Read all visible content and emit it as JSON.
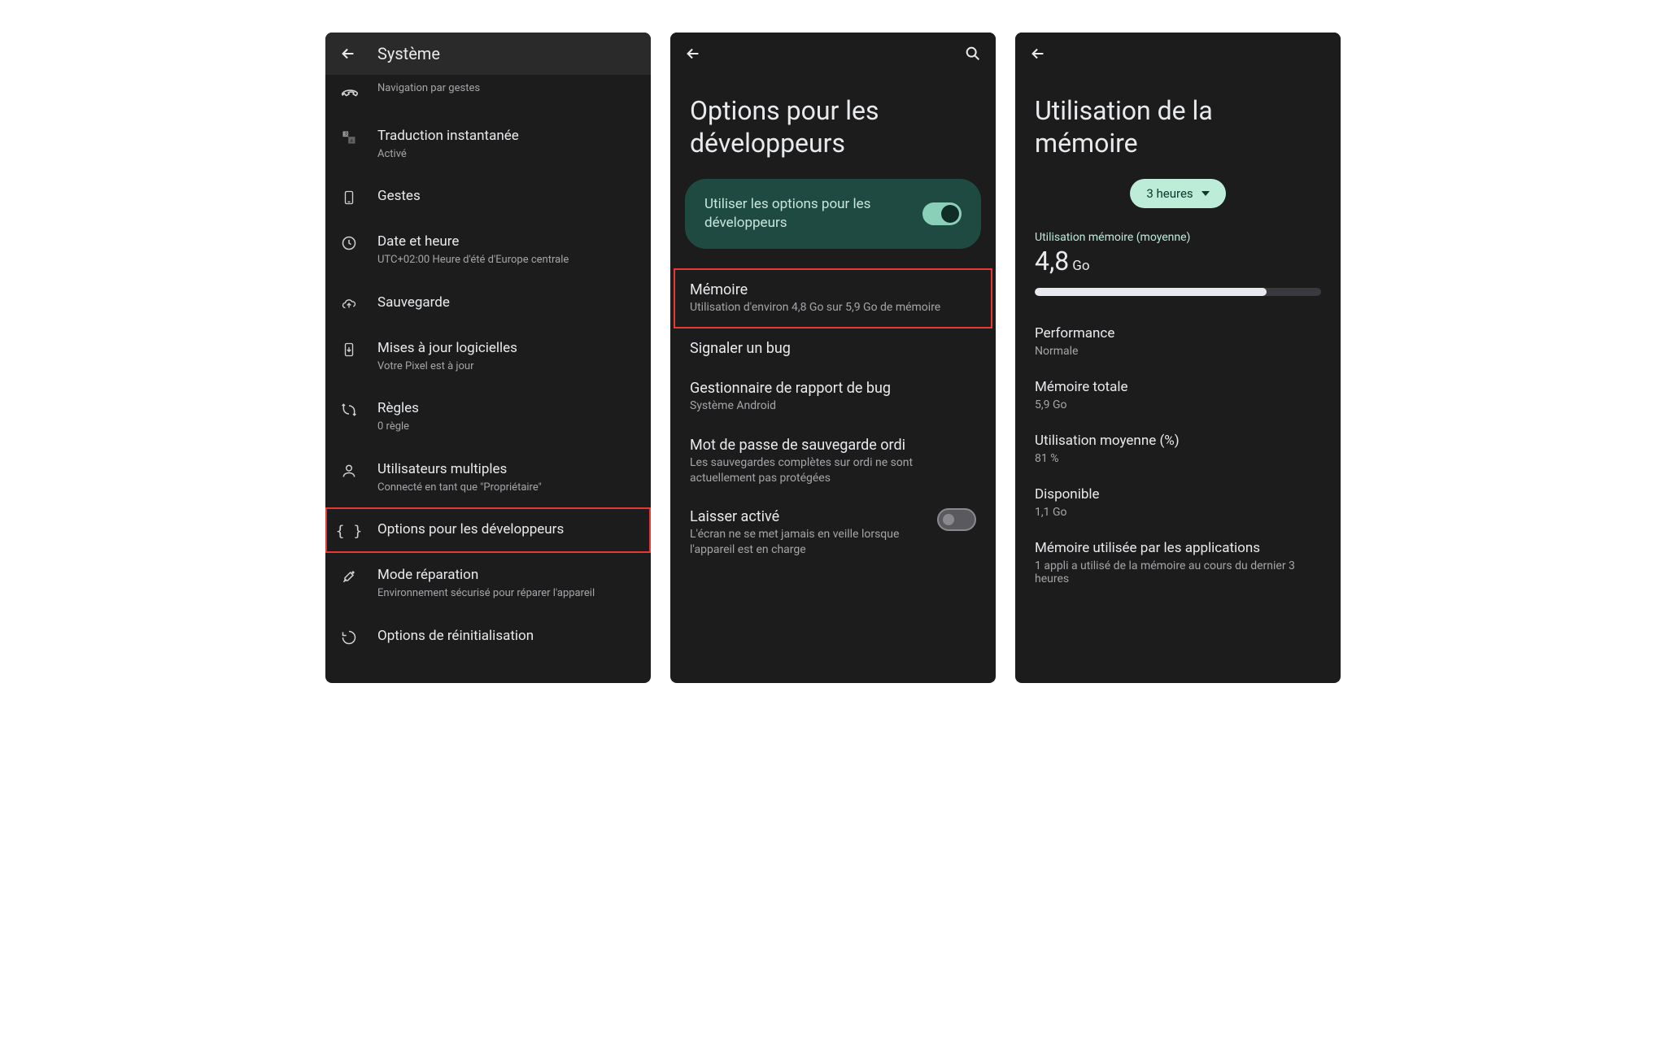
{
  "screen1": {
    "title": "Système",
    "items": [
      {
        "icon": "phone-down-icon",
        "label": "Navigation par gestes",
        "sub": null
      },
      {
        "icon": "translate-icon",
        "label": "Traduction instantanée",
        "sub": "Activé"
      },
      {
        "icon": "phone-icon",
        "label": "Gestes",
        "sub": null
      },
      {
        "icon": "clock-icon",
        "label": "Date et heure",
        "sub": "UTC+02:00 Heure d'été d'Europe centrale"
      },
      {
        "icon": "cloud-upload-icon",
        "label": "Sauvegarde",
        "sub": null
      },
      {
        "icon": "system-update-icon",
        "label": "Mises à jour logicielles",
        "sub": "Votre Pixel est à jour"
      },
      {
        "icon": "rules-icon",
        "label": "Règles",
        "sub": "0 règle"
      },
      {
        "icon": "user-icon",
        "label": "Utilisateurs multiples",
        "sub": "Connecté en tant que \"Propriétaire\""
      },
      {
        "icon": "braces-icon",
        "label": "Options pour les développeurs",
        "sub": null,
        "highlight": true
      },
      {
        "icon": "tools-icon",
        "label": "Mode réparation",
        "sub": "Environnement sécurisé pour réparer l'appareil"
      },
      {
        "icon": "reset-icon",
        "label": "Options de réinitialisation",
        "sub": null
      }
    ]
  },
  "screen2": {
    "title": "Options pour les développeurs",
    "toggle": {
      "label": "Utiliser les options pour les développeurs",
      "on": true
    },
    "items": [
      {
        "label": "Mémoire",
        "sub": "Utilisation d'environ 4,8 Go sur 5,9 Go de mémoire",
        "highlight": true
      },
      {
        "label": "Signaler un bug",
        "sub": null
      },
      {
        "label": "Gestionnaire de rapport de bug",
        "sub": "Système Android"
      },
      {
        "label": "Mot de passe de sauvegarde ordi",
        "sub": "Les sauvegardes complètes sur ordi ne sont actuellement pas protégées"
      },
      {
        "label": "Laisser activé",
        "sub": "L'écran ne se met jamais en veille lorsque l'appareil est en charge",
        "switch": "off"
      }
    ]
  },
  "screen3": {
    "title": "Utilisation de la mémoire",
    "chip": "3 heures",
    "avg_label": "Utilisation mémoire (moyenne)",
    "avg_value": "4,8",
    "avg_unit": "Go",
    "progress_pct": 81,
    "rows": [
      {
        "k": "Performance",
        "v": "Normale"
      },
      {
        "k": "Mémoire totale",
        "v": "5,9 Go"
      },
      {
        "k": "Utilisation moyenne (%)",
        "v": "81 %"
      },
      {
        "k": "Disponible",
        "v": "1,1 Go"
      },
      {
        "k": "Mémoire utilisée par les applications",
        "v": "1 appli a utilisé de la mémoire au cours du dernier 3 heures"
      }
    ]
  }
}
